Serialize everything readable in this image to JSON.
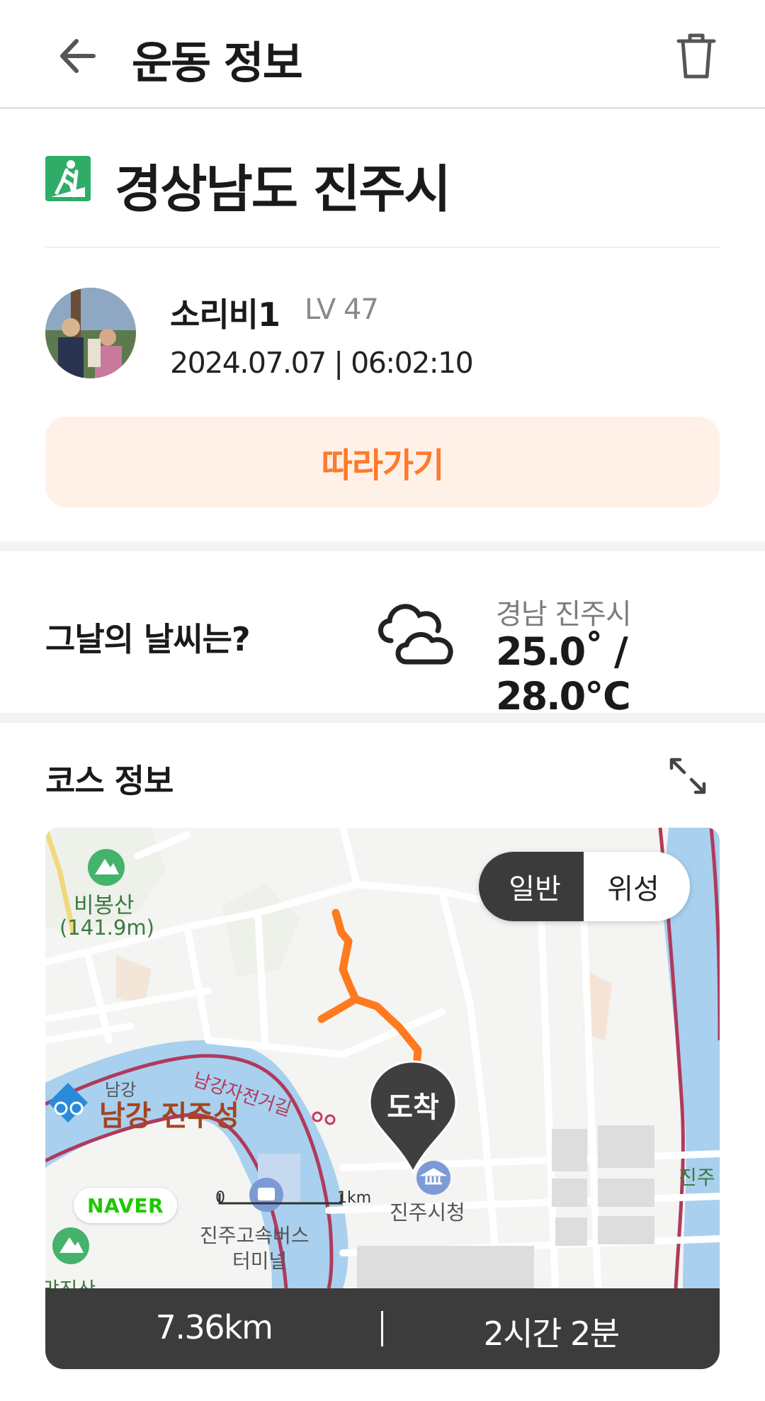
{
  "header": {
    "title": "운동 정보",
    "back_icon": "arrow-left-icon",
    "delete_icon": "trash-icon"
  },
  "activity": {
    "icon": "hiking-icon",
    "icon_color": "#2fad68",
    "title": "경상남도 진주시"
  },
  "user": {
    "name": "소리비1",
    "level": "LV 47",
    "datetime": "2024.07.07 | 06:02:10"
  },
  "follow_button": {
    "label": "따라가기",
    "text_color": "#ff7a2b",
    "bg_color": "#fff1e8"
  },
  "weather": {
    "question": "그날의 날씨는?",
    "icon": "cloud-icon",
    "location": "경남 진주시",
    "temperature": "25.0˚ / 28.0℃"
  },
  "course": {
    "title": "코스 정보",
    "expand_icon": "expand-icon",
    "map": {
      "toggle": {
        "normal": "일반",
        "satellite": "위성",
        "selected": "일반"
      },
      "end_marker": "도착",
      "route_color": "#ff7a1f",
      "labels": {
        "mountain_name": "비봉산",
        "mountain_height": "(141.9m)",
        "bike_road": "남강자전거길",
        "river_small": "남강",
        "castle": "남강 진주성",
        "city_hall": "진주시청",
        "bus_terminal_1": "진주고속버스",
        "bus_terminal_2": "터미널",
        "scale_0": "0",
        "scale_1": "1km",
        "right_edge": "진주",
        "bottom_left": "망진산",
        "naver": "NAVER"
      }
    },
    "stats": {
      "distance": "7.36km",
      "duration": "2시간 2분"
    }
  }
}
